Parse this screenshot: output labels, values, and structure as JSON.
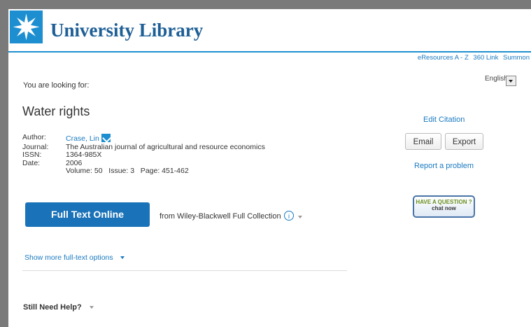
{
  "header": {
    "site_title": "University Library",
    "logo": "snowflake-star-logo",
    "brand_color": "#1d8fd0"
  },
  "toplinks": [
    "eResources A - Z",
    "360 Link",
    "Summon"
  ],
  "language": {
    "selected": "English"
  },
  "record": {
    "looking_for": "You are looking for:",
    "title": "Water rights",
    "author_label": "Author:",
    "author": "Crase, Lin",
    "journal_label": "Journal:",
    "journal": "The Australian journal of agricultural and resource economics",
    "issn_label": "ISSN:",
    "issn": "1364-985X",
    "date_label": "Date:",
    "date": "2006",
    "volume_line": "Volume: 50   Issue: 3   Page: 451-462"
  },
  "fulltext": {
    "button_label": "Full Text Online",
    "source": "from Wiley-Blackwell Full Collection",
    "info_glyph": "i",
    "more_options": "Show more full-text options"
  },
  "sidebar": {
    "edit_citation": "Edit Citation",
    "email": "Email",
    "export": "Export",
    "report": "Report a problem",
    "chat_line1": "HAVE A QUESTION ?",
    "chat_line2": "chat now"
  },
  "help": {
    "label": "Still Need Help?"
  }
}
